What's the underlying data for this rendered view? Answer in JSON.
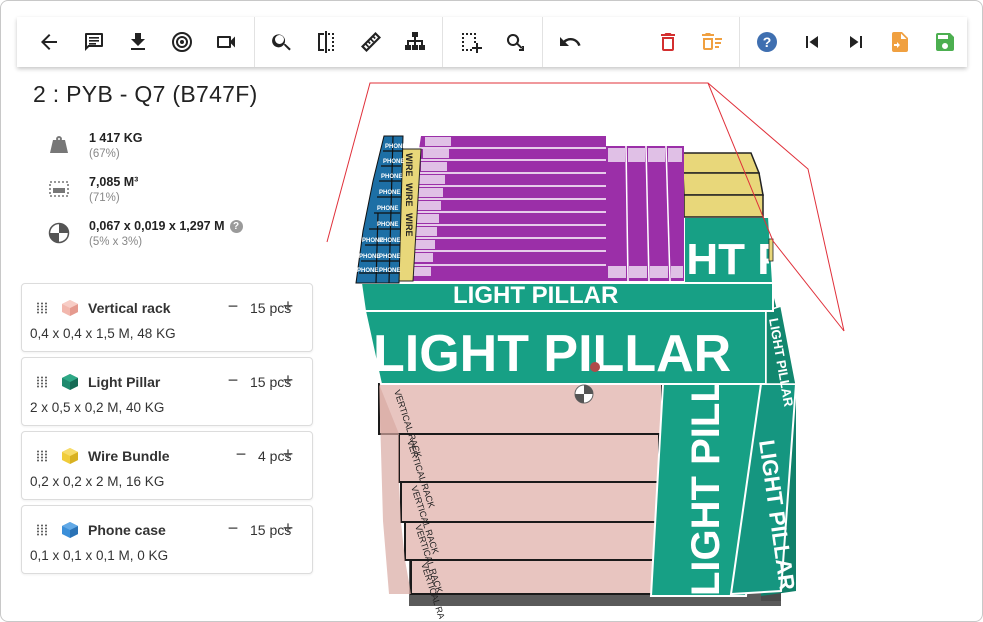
{
  "page_title": "2 : PYB - Q7 (B747F)",
  "toolbar": {
    "buttons": [
      {
        "name": "back-button",
        "icon": "arrow-left-icon"
      },
      {
        "name": "comment-button",
        "icon": "comment-icon"
      },
      {
        "name": "download-button",
        "icon": "download-icon"
      },
      {
        "name": "target-button",
        "icon": "target-icon"
      },
      {
        "name": "video-button",
        "icon": "video-icon"
      },
      {
        "name": "search-button",
        "icon": "search-icon"
      },
      {
        "name": "split-view-button",
        "icon": "split-icon"
      },
      {
        "name": "ruler-button",
        "icon": "ruler-icon"
      },
      {
        "name": "hierarchy-button",
        "icon": "hierarchy-icon"
      },
      {
        "name": "select-area-button",
        "icon": "select-area-icon"
      },
      {
        "name": "rotate-search-button",
        "icon": "rotate-search-icon"
      },
      {
        "name": "undo-button",
        "icon": "undo-icon"
      },
      {
        "name": "delete-button",
        "icon": "trash-icon"
      },
      {
        "name": "delete-list-button",
        "icon": "trash-list-icon"
      },
      {
        "name": "help-button",
        "icon": "help-icon"
      },
      {
        "name": "skip-previous-button",
        "icon": "skip-previous-icon"
      },
      {
        "name": "skip-next-button",
        "icon": "skip-next-icon"
      },
      {
        "name": "export-file-button",
        "icon": "file-export-icon"
      },
      {
        "name": "save-button",
        "icon": "save-icon"
      }
    ],
    "colors": {
      "default": "#222222",
      "delete": "#d32f2f",
      "delete_list": "#f0a040",
      "help": "#3f6fb0",
      "export": "#f0a040",
      "save": "#4caf50"
    }
  },
  "stats": {
    "weight": {
      "value": "1 417 KG",
      "pct": "(67%)",
      "icon": "weight-icon"
    },
    "volume": {
      "value": "7,085 M³",
      "pct": "(71%)",
      "icon": "volume-icon"
    },
    "dimensions": {
      "value": "0,067 x 0,019 x 1,297 M",
      "pct": "(5% x 3%)",
      "icon": "center-gravity-icon",
      "help": "?"
    }
  },
  "items": [
    {
      "name": "Vertical rack",
      "qty": "15 pcs",
      "dims": "0,4 x 0,4 x 1,5 M, 48 KG",
      "color": "#f2b7ad",
      "minus": "−",
      "plus": "+"
    },
    {
      "name": "Light Pillar",
      "qty": "15 pcs",
      "dims": "2 x 0,5 x 0,2 M, 40 KG",
      "color": "#1f8a6e",
      "minus": "−",
      "plus": "+"
    },
    {
      "name": "Wire Bundle",
      "qty": "4 pcs",
      "dims": "0,2 x 0,2 x 2 M, 16 KG",
      "color": "#f0cc3a",
      "minus": "−",
      "plus": "+"
    },
    {
      "name": "Phone case",
      "qty": "15 pcs",
      "dims": "0,1 x 0,1 x 0,1 M, 0 KG",
      "color": "#3b8fd9",
      "minus": "−",
      "plus": "+"
    }
  ],
  "scene": {
    "labels": {
      "light_pillar": "LIGHT PILLAR",
      "vertical_rack": "VERTICAL RACK",
      "wire": "WIRE",
      "phone": "PHONE"
    },
    "colors": {
      "pillar": "#17a085",
      "pillar_dark": "#10806a",
      "rack": "#e8c5c0",
      "wire_bundle": "#9b2fa8",
      "wire_top": "#b050c0",
      "phone": "#1d6fa5",
      "yellow": "#e8d77a",
      "outline": "#e0303a",
      "shadow": "#5a5a5a"
    }
  }
}
